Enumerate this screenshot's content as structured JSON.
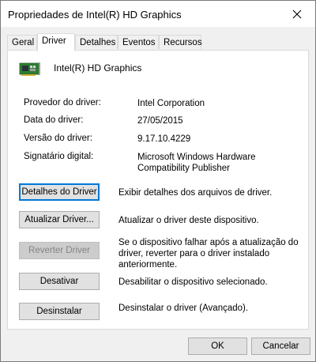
{
  "window": {
    "title": "Propriedades de Intel(R) HD Graphics"
  },
  "tabs": [
    "Geral",
    "Driver",
    "Detalhes",
    "Eventos",
    "Recursos"
  ],
  "active_tab": "Driver",
  "device": {
    "name": "Intel(R) HD Graphics",
    "icon": "display-adapter-icon"
  },
  "info": {
    "provider_label": "Provedor do driver:",
    "provider_value": "Intel Corporation",
    "date_label": "Data do driver:",
    "date_value": "27/05/2015",
    "version_label": "Versão do driver:",
    "version_value": "9.17.10.4229",
    "signer_label": "Signatário digital:",
    "signer_value": "Microsoft Windows Hardware Compatibility Publisher"
  },
  "actions": {
    "details_label": "Detalhes do Driver",
    "details_desc": "Exibir detalhes dos arquivos de driver.",
    "update_label": "Atualizar Driver...",
    "update_desc": "Atualizar o driver deste dispositivo.",
    "rollback_label": "Reverter Driver",
    "rollback_desc": "Se o dispositivo falhar após a atualização do driver, reverter para o driver instalado anteriormente.",
    "disable_label": "Desativar",
    "disable_desc": "Desabilitar o dispositivo selecionado.",
    "uninstall_label": "Desinstalar",
    "uninstall_desc": "Desinstalar o driver (Avançado)."
  },
  "footer": {
    "ok_label": "OK",
    "cancel_label": "Cancelar"
  },
  "colors": {
    "focus_border": "#0078d7",
    "dialog_bg": "#f0f0f0",
    "panel_bg": "#ffffff"
  }
}
